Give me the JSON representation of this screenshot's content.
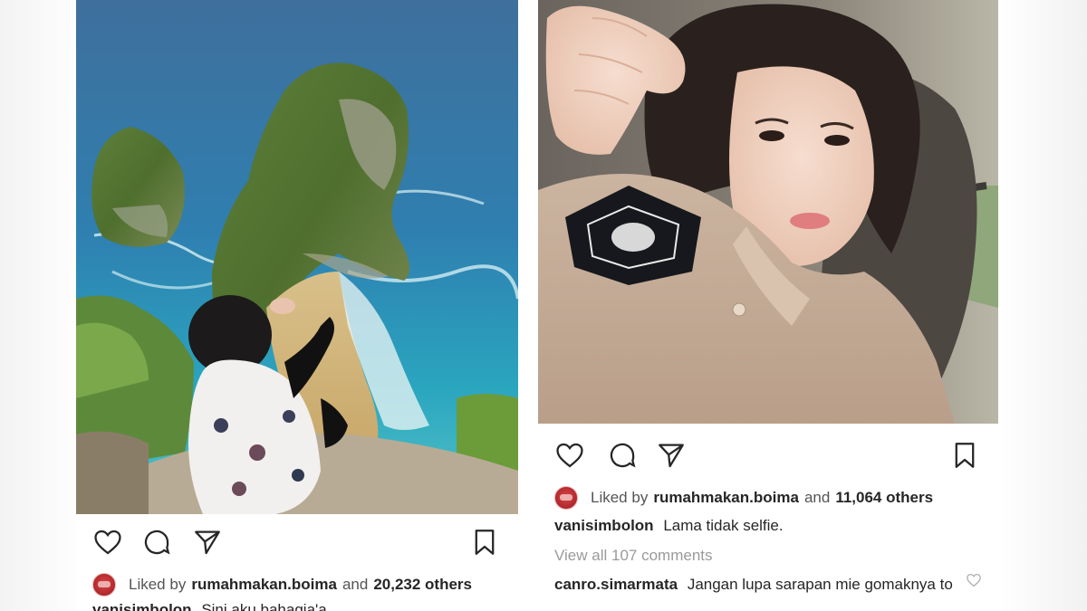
{
  "posts": [
    {
      "photo_subject": "beach-cliff-photo",
      "liked_by_prefix": "Liked by",
      "liked_by_user": "rumahmakan.boima",
      "liked_by_and": "and",
      "likes_others": "20,232 others",
      "caption_user": "vanisimbolon",
      "caption_text": "Sini aku bahagia'a"
    },
    {
      "photo_subject": "selfie-photo",
      "liked_by_prefix": "Liked by",
      "liked_by_user": "rumahmakan.boima",
      "liked_by_and": "and",
      "likes_others": "11,064 others",
      "caption_user": "vanisimbolon",
      "caption_text": "Lama tidak selfie.",
      "view_comments": "View all 107 comments",
      "comment": {
        "user": "canro.simarmata",
        "text": "Jangan lupa sarapan mie gomaknya to"
      }
    }
  ],
  "icons": {
    "like": "heart-icon",
    "comment": "comment-bubble-icon",
    "share": "paper-plane-icon",
    "save": "bookmark-icon"
  },
  "colors": {
    "text": "#262626",
    "muted": "#9a9a9a",
    "icon_stroke": "#262626"
  }
}
